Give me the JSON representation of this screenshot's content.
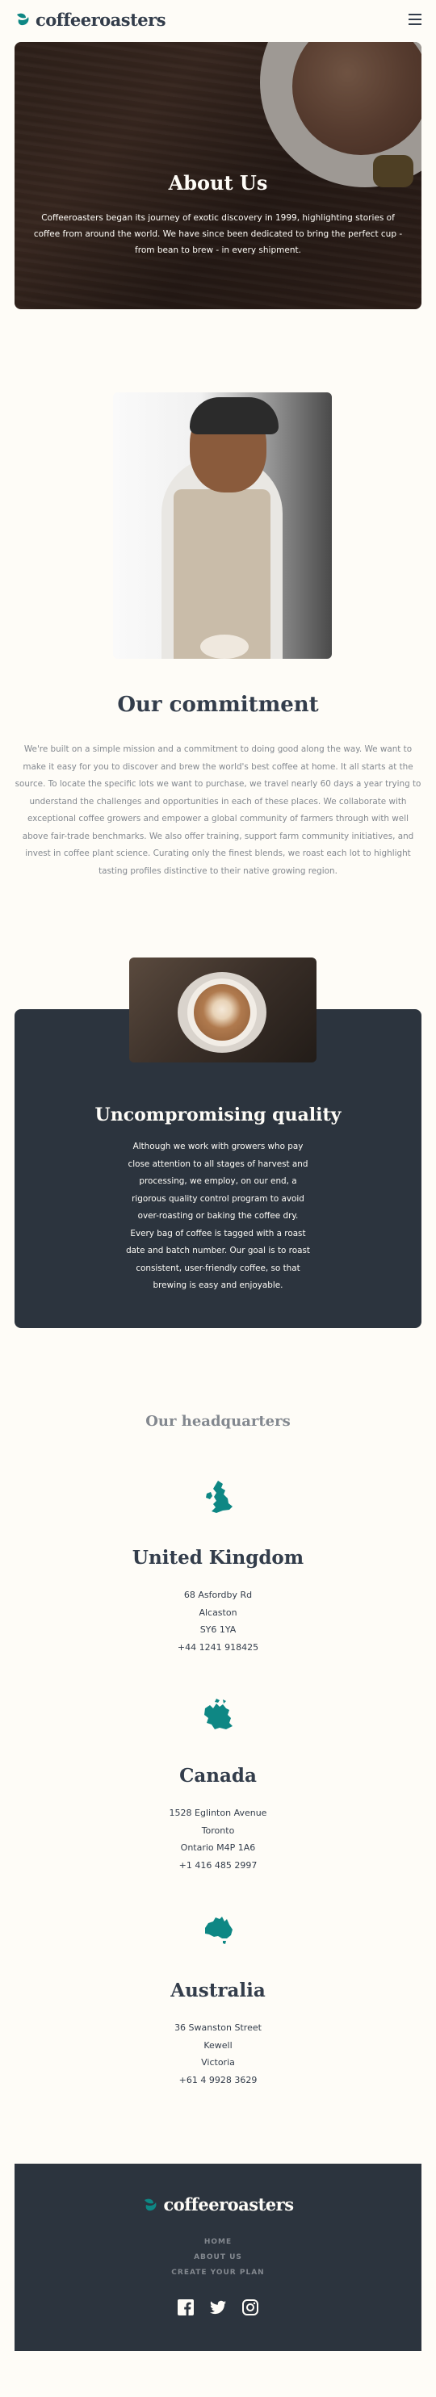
{
  "brand": {
    "name": "coffeeroasters",
    "accent": "#0E8784",
    "dark": "#2C343E",
    "cream": "#FEFCF7",
    "grey": "#83888F"
  },
  "header": {
    "menu_icon": "hamburger-icon"
  },
  "hero": {
    "title": "About Us",
    "text": "Coffeeroasters began its journey of exotic discovery in 1999, highlighting stories of coffee from around the world. We have since been dedicated to bring the perfect cup - from bean to brew - in every shipment."
  },
  "commitment": {
    "title": "Our commitment",
    "text": "We're built on a simple mission and a commitment to doing good along the way. We want to make it easy for you to discover and brew the world's best coffee at home. It all starts at the source. To locate the specific lots we want to purchase, we travel nearly 60 days a year trying to understand the challenges and opportunities in each of these places. We collaborate with exceptional coffee growers and empower a global community of farmers through with well above fair-trade benchmarks. We also offer training, support farm community initiatives, and invest in coffee plant science. Curating only the finest blends, we roast each lot to highlight tasting profiles distinctive to their native growing region."
  },
  "quality": {
    "title": "Uncompromising quality",
    "text": "Although we work with growers who pay close attention to all stages of harvest and processing, we employ, on our end, a rigorous quality control program to avoid over-roasting or baking the coffee dry. Every bag of coffee is tagged with a roast date and batch number. Our goal is to roast consistent, user-friendly coffee, so that brewing is easy and enjoyable."
  },
  "headquarters": {
    "title": "Our headquarters",
    "locations": [
      {
        "icon": "uk-map-icon",
        "country": "United Kingdom",
        "lines": [
          "68 Asfordby Rd",
          "Alcaston",
          "SY6 1YA",
          "+44 1241 918425"
        ]
      },
      {
        "icon": "canada-map-icon",
        "country": "Canada",
        "lines": [
          "1528 Eglinton Avenue",
          "Toronto",
          "Ontario M4P 1A6",
          "+1 416 485 2997"
        ]
      },
      {
        "icon": "australia-map-icon",
        "country": "Australia",
        "lines": [
          "36 Swanston Street",
          "Kewell",
          "Victoria",
          "+61 4 9928 3629"
        ]
      }
    ]
  },
  "footer": {
    "nav": [
      "HOME",
      "ABOUT US",
      "CREATE YOUR PLAN"
    ],
    "socials": [
      "facebook-icon",
      "twitter-icon",
      "instagram-icon"
    ]
  }
}
